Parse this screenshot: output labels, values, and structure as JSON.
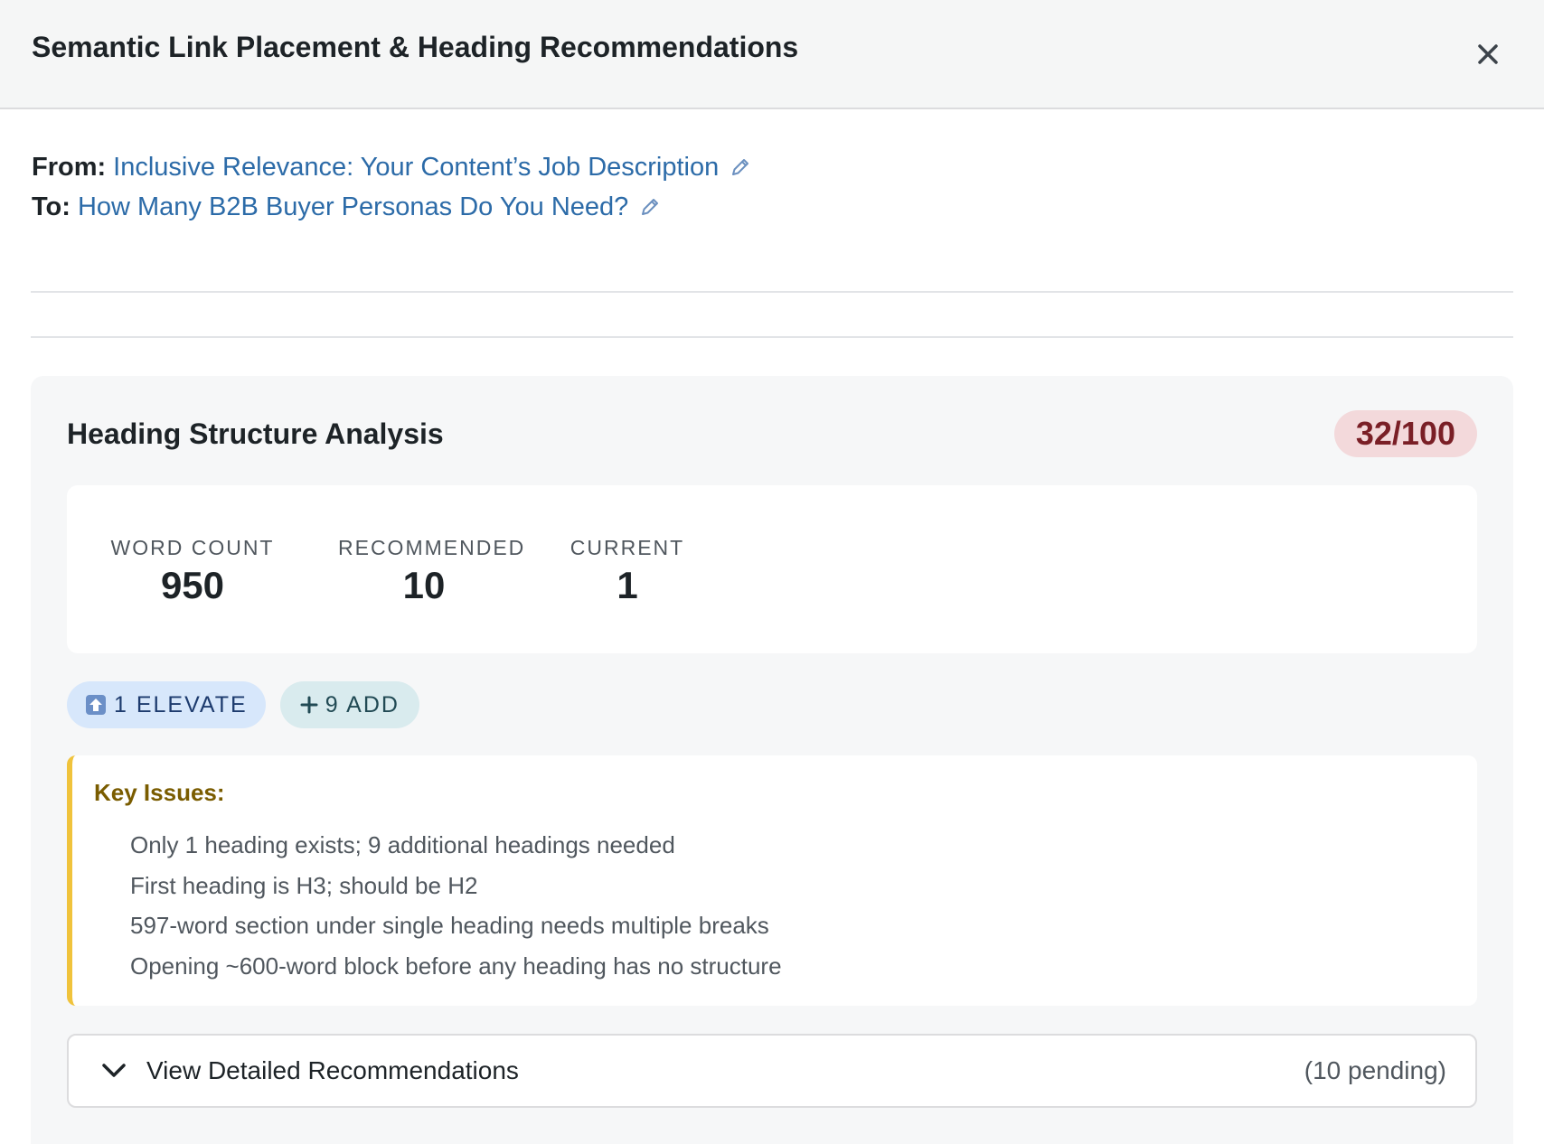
{
  "header": {
    "title": "Semantic Link Placement & Heading Recommendations",
    "close_icon": "close-icon"
  },
  "link": {
    "from_label": "From:",
    "from_value": "Inclusive Relevance: Your Content’s Job Description",
    "to_label": "To:",
    "to_value": "How Many B2B Buyer Personas Do You Need?"
  },
  "analysis": {
    "title": "Heading Structure Analysis",
    "score": "32/100",
    "stats": [
      {
        "label": "WORD COUNT",
        "value": "950"
      },
      {
        "label": "RECOMMENDED",
        "value": "10"
      },
      {
        "label": "CURRENT",
        "value": "1"
      }
    ],
    "pills": {
      "elevate": "1 ELEVATE",
      "add": "9 ADD"
    },
    "issues_title": "Key Issues:",
    "issues": [
      "Only 1 heading exists; 9 additional headings needed",
      "First heading is H3; should be H2",
      "597-word section under single heading needs multiple breaks",
      "Opening ~600-word block before any heading has no structure"
    ],
    "details": {
      "label": "View Detailed Recommendations",
      "count": "(10 pending)"
    }
  },
  "colors": {
    "link": "#2c6ba8",
    "score_bg": "#f3d9db",
    "score_text": "#7a1f26",
    "issues_accent": "#f0c33c",
    "elevate_bg": "#d7e7fb",
    "add_bg": "#d9ebee"
  }
}
